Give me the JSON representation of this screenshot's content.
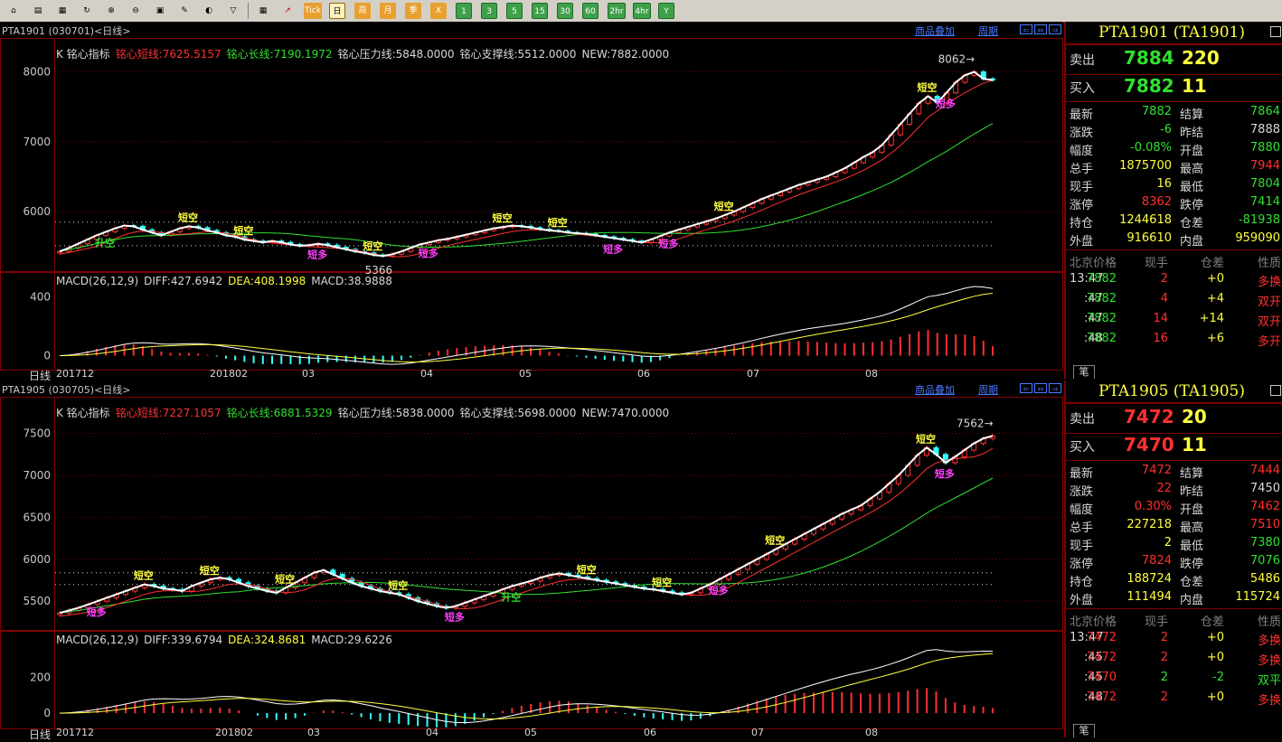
{
  "toolbar": {
    "buttons": [
      {
        "icon": "home-icon",
        "t": "⌂"
      },
      {
        "icon": "list-icon",
        "t": "▤"
      },
      {
        "icon": "chart-icon",
        "t": "▦"
      },
      {
        "icon": "refresh-icon",
        "t": "↻"
      },
      {
        "icon": "zoom-in-icon",
        "t": "⊕"
      },
      {
        "icon": "zoom-out-icon",
        "t": "⊖"
      },
      {
        "icon": "window-icon",
        "t": "▣"
      },
      {
        "icon": "draw-icon",
        "t": "✎"
      },
      {
        "icon": "paint-icon",
        "t": "◐"
      },
      {
        "icon": "filter-icon",
        "t": "▽"
      }
    ],
    "periods": [
      "Tick",
      "日",
      "周",
      "月",
      "季",
      "X",
      "1",
      "3",
      "5",
      "15",
      "30",
      "60",
      "2hr",
      "4hr",
      "Y"
    ]
  },
  "panels": [
    {
      "header": {
        "title": "PTA1901 (030701)<日线>",
        "overlay": "商品叠加",
        "cycle": "周期"
      },
      "kline": {
        "prefix": "K  铭心指标",
        "short_line": "铭心短线:7625.5157",
        "long_line": "铭心长线:7190.1972",
        "pressure": "铭心压力线:5848.0000",
        "support": "铭心支撑线:5512.0000",
        "new": "NEW:7882.0000",
        "y_ticks": [
          "8000",
          "7000",
          "6000"
        ],
        "high_label": "8062",
        "low_label": "5366"
      },
      "macd": {
        "prefix": "MACD(26,12,9)",
        "diff": "DIFF:427.6942",
        "dea": "DEA:408.1998",
        "macd": "MACD:38.9888",
        "y_ticks": [
          "400",
          "0"
        ]
      },
      "axis": {
        "label": "日线",
        "months": [
          "201712",
          "201802",
          "03",
          "04",
          "05",
          "06",
          "07",
          "08"
        ]
      },
      "quote": {
        "title": "PTA1901 (TA1901)",
        "sell": {
          "label": "卖出",
          "price": "7884",
          "vol": "220"
        },
        "buy": {
          "label": "买入",
          "price": "7882",
          "vol": "11"
        },
        "stats": [
          [
            "最新",
            "7882",
            "结算",
            "7864"
          ],
          [
            "涨跌",
            "-6",
            "昨结",
            "7888"
          ],
          [
            "幅度",
            "-0.08%",
            "开盘",
            "7880"
          ],
          [
            "总手",
            "1875700",
            "最高",
            "7944"
          ],
          [
            "现手",
            "16",
            "最低",
            "7804"
          ],
          [
            "涨停",
            "8362",
            "跌停",
            "7414"
          ],
          [
            "持仓",
            "1244618",
            "仓差",
            "-81938"
          ],
          [
            "外盘",
            "916610",
            "内盘",
            "959090"
          ]
        ],
        "trade_header": [
          "北京",
          "价格",
          "现手",
          "仓差",
          "性质"
        ],
        "trades": [
          [
            "13:47",
            "7882",
            "2",
            "+0",
            "多换"
          ],
          [
            ":47",
            "7882",
            "4",
            "+4",
            "双开"
          ],
          [
            ":47",
            "7882",
            "14",
            "+14",
            "双开"
          ],
          [
            ":48",
            "7882",
            "16",
            "+6",
            "多开"
          ]
        ],
        "tab": "笔"
      }
    },
    {
      "header": {
        "title": "PTA1905 (030705)<日线>",
        "overlay": "商品叠加",
        "cycle": "周期"
      },
      "kline": {
        "prefix": "K  铭心指标",
        "short_line": "铭心短线:7227.1057",
        "long_line": "铭心长线:6881.5329",
        "pressure": "铭心压力线:5838.0000",
        "support": "铭心支撑线:5698.0000",
        "new": "NEW:7470.0000",
        "y_ticks": [
          "7500",
          "7000",
          "6500",
          "6000",
          "5500"
        ],
        "high_label": "7562",
        "low_label": ""
      },
      "macd": {
        "prefix": "MACD(26,12,9)",
        "diff": "DIFF:339.6794",
        "dea": "DEA:324.8681",
        "macd": "MACD:29.6226",
        "y_ticks": [
          "200",
          "0"
        ]
      },
      "axis": {
        "label": "日线",
        "months": [
          "201712",
          "201802",
          "03",
          "04",
          "05",
          "06",
          "07",
          "08"
        ]
      },
      "quote": {
        "title": "PTA1905 (TA1905)",
        "sell": {
          "label": "卖出",
          "price": "7472",
          "vol": "20"
        },
        "buy": {
          "label": "买入",
          "price": "7470",
          "vol": "11"
        },
        "stats": [
          [
            "最新",
            "7472",
            "结算",
            "7444"
          ],
          [
            "涨跌",
            "22",
            "昨结",
            "7450"
          ],
          [
            "幅度",
            "0.30%",
            "开盘",
            "7462"
          ],
          [
            "总手",
            "227218",
            "最高",
            "7510"
          ],
          [
            "现手",
            "2",
            "最低",
            "7380"
          ],
          [
            "涨停",
            "7824",
            "跌停",
            "7076"
          ],
          [
            "持仓",
            "188724",
            "仓差",
            "5486"
          ],
          [
            "外盘",
            "111494",
            "内盘",
            "115724"
          ]
        ],
        "trade_header": [
          "北京",
          "价格",
          "现手",
          "仓差",
          "性质"
        ],
        "trades": [
          [
            "13:47",
            "7472",
            "2",
            "+0",
            "多换"
          ],
          [
            ":45",
            "7472",
            "2",
            "+0",
            "多换"
          ],
          [
            ":45",
            "7470",
            "2",
            "-2",
            "双平"
          ],
          [
            ":48",
            "7472",
            "2",
            "+0",
            "多换"
          ]
        ],
        "tab": "笔"
      }
    }
  ],
  "signals": {
    "short": "短空",
    "long": "短多",
    "rise": "升空"
  },
  "colors": {
    "up": "#ff3030",
    "down": "#30e030",
    "frame": "#800000",
    "link": "#4a7aff",
    "title": "#ffff40",
    "signal_short": "#ffff40",
    "signal_long": "#ff40ff"
  },
  "series": {
    "p1_close": [
      5430,
      5480,
      5540,
      5600,
      5660,
      5710,
      5760,
      5800,
      5790,
      5740,
      5700,
      5660,
      5710,
      5760,
      5790,
      5770,
      5730,
      5700,
      5660,
      5640,
      5600,
      5580,
      5560,
      5580,
      5560,
      5530,
      5510,
      5520,
      5540,
      5520,
      5490,
      5460,
      5430,
      5410,
      5380,
      5366,
      5390,
      5430,
      5480,
      5530,
      5560,
      5590,
      5610,
      5640,
      5670,
      5700,
      5730,
      5760,
      5780,
      5800,
      5790,
      5770,
      5750,
      5730,
      5720,
      5700,
      5690,
      5680,
      5660,
      5640,
      5620,
      5600,
      5580,
      5560,
      5600,
      5650,
      5700,
      5740,
      5780,
      5820,
      5860,
      5900,
      5950,
      6000,
      6060,
      6120,
      6180,
      6230,
      6280,
      6330,
      6380,
      6420,
      6460,
      6500,
      6560,
      6620,
      6700,
      6780,
      6850,
      6950,
      7100,
      7250,
      7400,
      7550,
      7650,
      7560,
      7700,
      7850,
      7950,
      8000,
      7900,
      7882
    ],
    "p2_close": [
      5360,
      5390,
      5420,
      5460,
      5500,
      5540,
      5580,
      5620,
      5660,
      5700,
      5680,
      5650,
      5640,
      5620,
      5680,
      5720,
      5760,
      5780,
      5760,
      5720,
      5680,
      5650,
      5620,
      5600,
      5660,
      5720,
      5780,
      5840,
      5870,
      5820,
      5770,
      5720,
      5680,
      5650,
      5620,
      5600,
      5580,
      5540,
      5500,
      5470,
      5440,
      5420,
      5440,
      5480,
      5520,
      5560,
      5600,
      5640,
      5680,
      5710,
      5740,
      5780,
      5810,
      5830,
      5810,
      5790,
      5770,
      5750,
      5730,
      5710,
      5690,
      5670,
      5650,
      5640,
      5620,
      5600,
      5580,
      5600,
      5650,
      5700,
      5760,
      5820,
      5880,
      5940,
      6000,
      6060,
      6120,
      6180,
      6240,
      6300,
      6360,
      6420,
      6480,
      6540,
      6590,
      6640,
      6720,
      6800,
      6900,
      7000,
      7120,
      7240,
      7330,
      7250,
      7150,
      7220,
      7300,
      7380,
      7440,
      7470
    ]
  }
}
